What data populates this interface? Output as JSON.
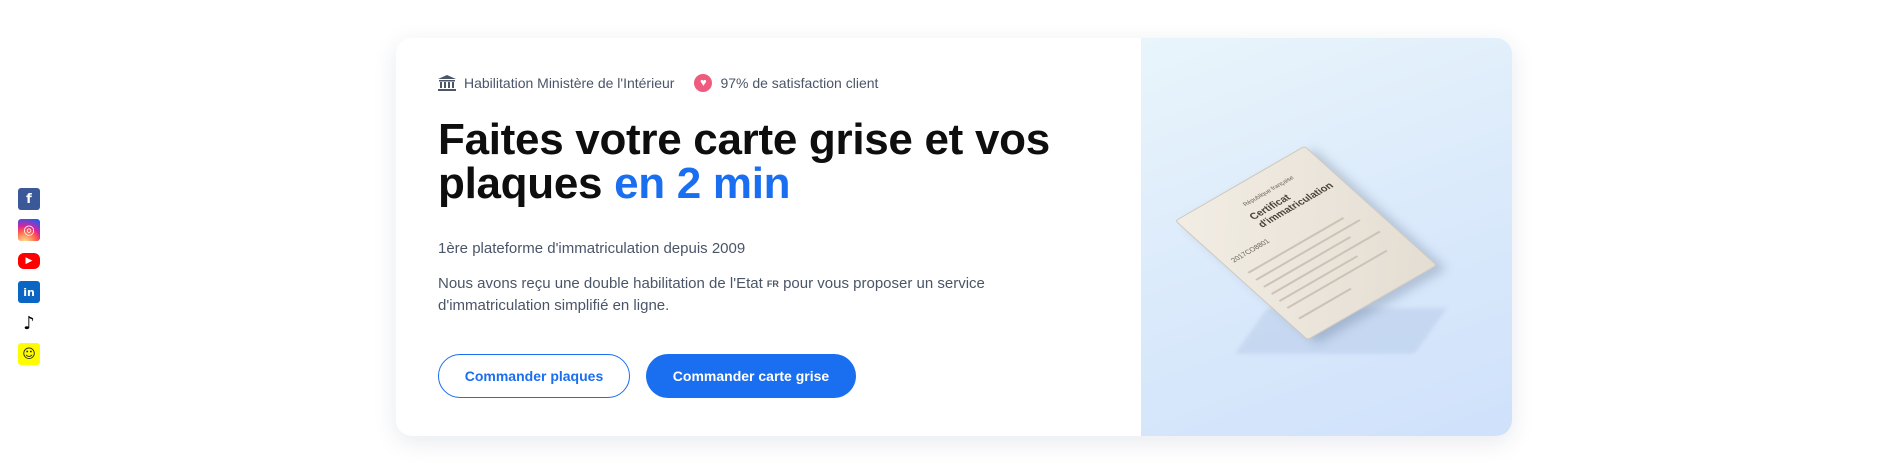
{
  "social": [
    {
      "name": "facebook",
      "glyph": "f"
    },
    {
      "name": "instagram",
      "glyph": "◎"
    },
    {
      "name": "youtube",
      "glyph": "▶"
    },
    {
      "name": "linkedin",
      "glyph": "in"
    },
    {
      "name": "tiktok",
      "glyph": "♪"
    },
    {
      "name": "snapchat",
      "glyph": "☺"
    }
  ],
  "badges": {
    "ministry": "Habilitation Ministère de l'Intérieur",
    "satisfaction": "97% de satisfaction client"
  },
  "hero": {
    "title_main": "Faites votre carte grise et vos plaques",
    "title_accent": "en 2 min",
    "tagline": "1ère plateforme d'immatriculation depuis 2009",
    "desc_before": "Nous avons reçu une double habilitation de l'Etat",
    "desc_fr": "FR",
    "desc_after": "pour vous proposer un service d'immatriculation simplifié en ligne."
  },
  "buttons": {
    "plates": "Commander plaques",
    "card": "Commander carte grise"
  },
  "document": {
    "title": "Certificat d'immatriculation",
    "header": "République française",
    "number": "2017CO8801"
  },
  "colors": {
    "accent": "#1a6ef0",
    "heart": "#ef5b7e",
    "text_muted": "#4a5568"
  }
}
